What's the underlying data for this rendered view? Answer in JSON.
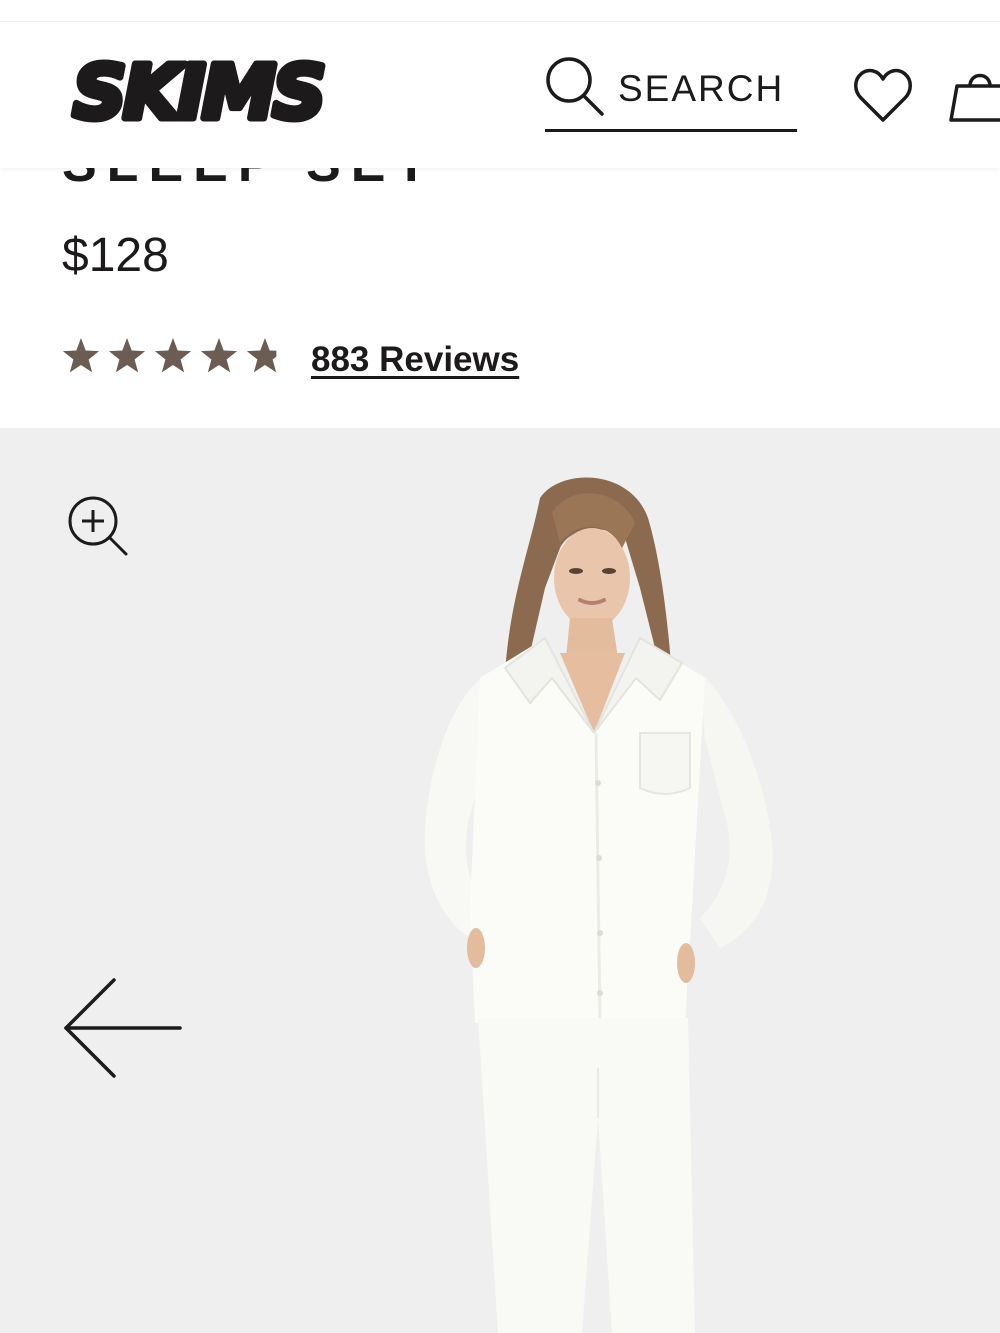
{
  "header": {
    "logo_text": "SKIMS",
    "search_label": "SEARCH",
    "icons": [
      "search-icon",
      "heart-icon",
      "bag-icon"
    ]
  },
  "product": {
    "title": "SLEEP SET",
    "price": "$128",
    "rating": 4.8,
    "rating_max": 5,
    "reviews_label": "883 Reviews"
  },
  "gallery": {
    "icons": [
      "zoom-in-icon",
      "arrow-left-icon"
    ]
  },
  "colors": {
    "text": "#1c1a1a",
    "star": "#6b5d53",
    "gallery_bg": "#efefef",
    "garment": "#fbfbf8",
    "hair": "#8b6a4f"
  }
}
